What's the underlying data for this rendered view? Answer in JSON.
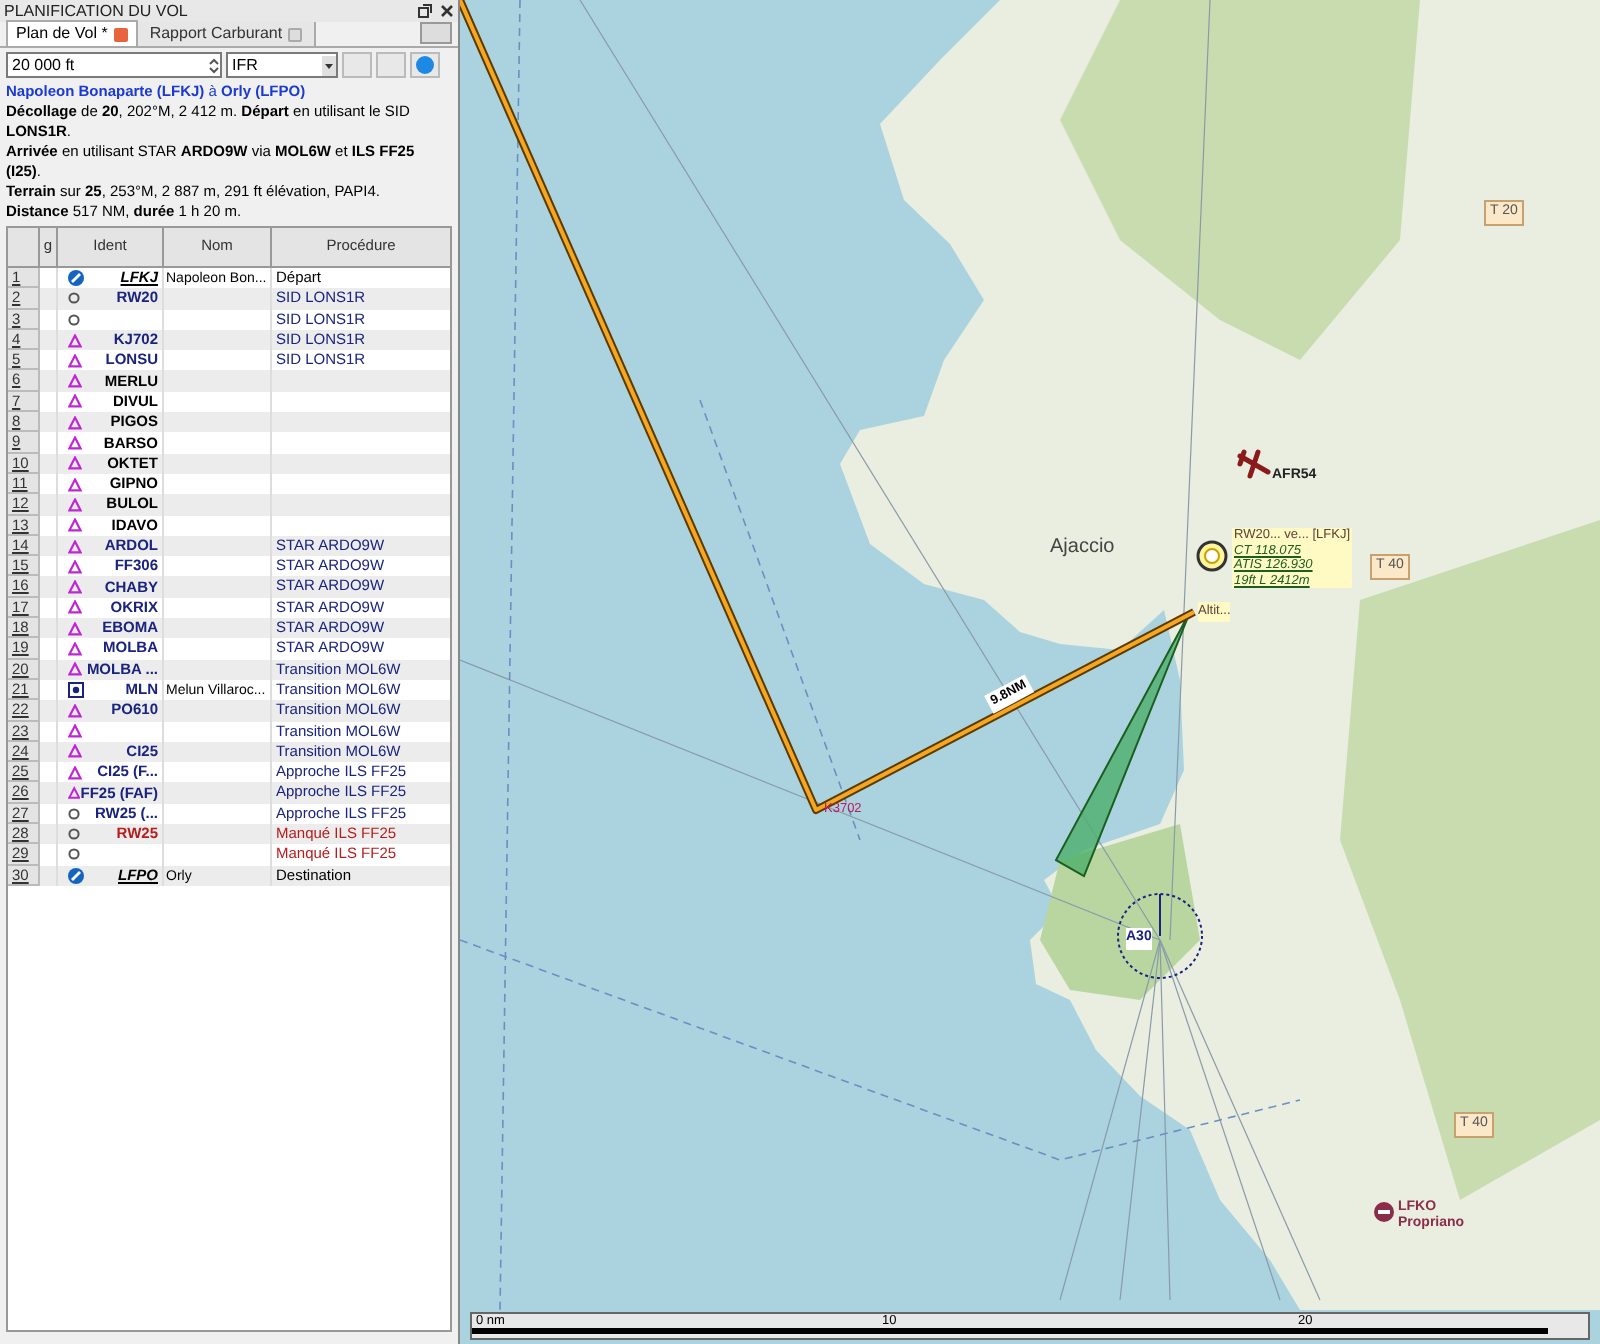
{
  "panel": {
    "title": "PLANIFICATION DU VOL"
  },
  "tabs": [
    {
      "label": "Plan de Vol *",
      "selected": true
    },
    {
      "label": "Rapport Carburant",
      "selected": false
    }
  ],
  "altitude": {
    "value": "20 000 ft"
  },
  "flight_rules": {
    "value": "IFR"
  },
  "summary": [
    "**Napoleon Bonaparte (LFKJ)** à **Orly (LFPO)**",
    "**Décollage** de **20**, 202°M, 2 412 m. **Départ** en utilisant le SID **LONS1R**.",
    "**Arrivée** en utilisant STAR **ARDO9W** via **MOL6W** et **ILS FF25 (I25)**.",
    "**Terrain** sur **25**, 253°M, 2 887 m, 291 ft élévation, PAPI4.",
    "**Distance** 517 NM, **durée** 1 h 20 m."
  ],
  "table": {
    "columns": [
      "g",
      "Ident",
      "Nom",
      "Procédure"
    ],
    "rows": [
      {
        "number": "1",
        "kind": "airport",
        "ident": "LFKJ",
        "color": "#000000",
        "name": "Napoleon Bon...",
        "procedure": "Départ"
      },
      {
        "number": "2",
        "kind": "runway",
        "ident": "RW20",
        "color": "#1a237e",
        "procedure": "SID LONS1R"
      },
      {
        "number": "3",
        "kind": "runway",
        "color": "#1a237e",
        "procedure": "SID LONS1R"
      },
      {
        "number": "4",
        "kind": "waypoint",
        "ident": "KJ702",
        "color": "#1a237e",
        "procedure": "SID LONS1R"
      },
      {
        "number": "5",
        "kind": "waypoint",
        "ident": "LONSU",
        "color": "#1a237e",
        "procedure": "SID LONS1R"
      },
      {
        "number": "6",
        "kind": "waypoint",
        "ident": "MERLU",
        "color": "#000000"
      },
      {
        "number": "7",
        "kind": "waypoint",
        "ident": "DIVUL",
        "color": "#000000"
      },
      {
        "number": "8",
        "kind": "waypoint",
        "ident": "PIGOS",
        "color": "#000000"
      },
      {
        "number": "9",
        "kind": "waypoint",
        "ident": "BARSO",
        "color": "#000000"
      },
      {
        "number": "10",
        "kind": "waypoint",
        "ident": "OKTET",
        "color": "#000000"
      },
      {
        "number": "11",
        "kind": "waypoint",
        "ident": "GIPNO",
        "color": "#000000"
      },
      {
        "number": "12",
        "kind": "waypoint",
        "ident": "BULOL",
        "color": "#000000"
      },
      {
        "number": "13",
        "kind": "waypoint",
        "ident": "IDAVO",
        "color": "#000000"
      },
      {
        "number": "14",
        "kind": "waypoint",
        "ident": "ARDOL",
        "color": "#1a237e",
        "procedure": "STAR ARDO9W"
      },
      {
        "number": "15",
        "kind": "waypoint",
        "ident": "FF306",
        "color": "#1a237e",
        "procedure": "STAR ARDO9W"
      },
      {
        "number": "16",
        "kind": "waypoint",
        "ident": "CHABY",
        "color": "#1a237e",
        "procedure": "STAR ARDO9W"
      },
      {
        "number": "17",
        "kind": "waypoint",
        "ident": "OKRIX",
        "color": "#1a237e",
        "procedure": "STAR ARDO9W"
      },
      {
        "number": "18",
        "kind": "waypoint",
        "ident": "EBOMA",
        "color": "#1a237e",
        "procedure": "STAR ARDO9W"
      },
      {
        "number": "19",
        "kind": "waypoint",
        "ident": "MOLBA",
        "color": "#1a237e",
        "procedure": "STAR ARDO9W"
      },
      {
        "number": "20",
        "kind": "waypoint",
        "ident": "MOLBA ...",
        "color": "#1a237e",
        "procedure": "Transition MOL6W"
      },
      {
        "number": "21",
        "kind": "vor",
        "ident": "MLN",
        "color": "#1a237e",
        "name": "Melun Villaroc...",
        "procedure": "Transition MOL6W"
      },
      {
        "number": "22",
        "kind": "waypoint",
        "ident": "PO610",
        "color": "#1a237e",
        "procedure": "Transition MOL6W"
      },
      {
        "number": "23",
        "kind": "waypoint",
        "color": "#1a237e",
        "procedure": "Transition MOL6W"
      },
      {
        "number": "24",
        "kind": "waypoint",
        "ident": "CI25",
        "color": "#1a237e",
        "procedure": "Transition MOL6W"
      },
      {
        "number": "25",
        "kind": "waypoint",
        "ident": "CI25 (F...",
        "color": "#1a237e",
        "procedure": "Approche ILS FF25"
      },
      {
        "number": "26",
        "kind": "waypoint",
        "ident": "FF25 (FAF)",
        "color": "#1a237e",
        "procedure": "Approche ILS FF25"
      },
      {
        "number": "27",
        "kind": "runway",
        "ident": "RW25 (...",
        "color": "#1a237e",
        "procedure": "Approche ILS FF25"
      },
      {
        "number": "28",
        "kind": "runway",
        "ident": "RW25",
        "color": "#b71c1c",
        "procedure": "Manqué ILS FF25"
      },
      {
        "number": "29",
        "kind": "runway",
        "color": "#b71c1c",
        "procedure": "Manqué ILS FF25"
      },
      {
        "number": "30",
        "kind": "airport",
        "ident": "LFPO",
        "color": "#000000",
        "name": "Orly",
        "procedure": "Destination"
      }
    ]
  },
  "map": {
    "city": "Ajaccio",
    "roads": [
      "T 20",
      "T 40",
      "T 40"
    ],
    "aircraft_label": "AFR54",
    "leg_label": "9.8NM",
    "waypoint_label": "K3702",
    "navaid_label": "A30",
    "airport_info": [
      "RW20... ve... [LFKJ]",
      "CT 118.075",
      "ATIS 126.930",
      "19ft L 2412m"
    ],
    "altitude_label": "Altit...",
    "destination": [
      "LFKO",
      "Propriano"
    ],
    "scale": [
      "0 nm",
      "10",
      "20"
    ]
  }
}
